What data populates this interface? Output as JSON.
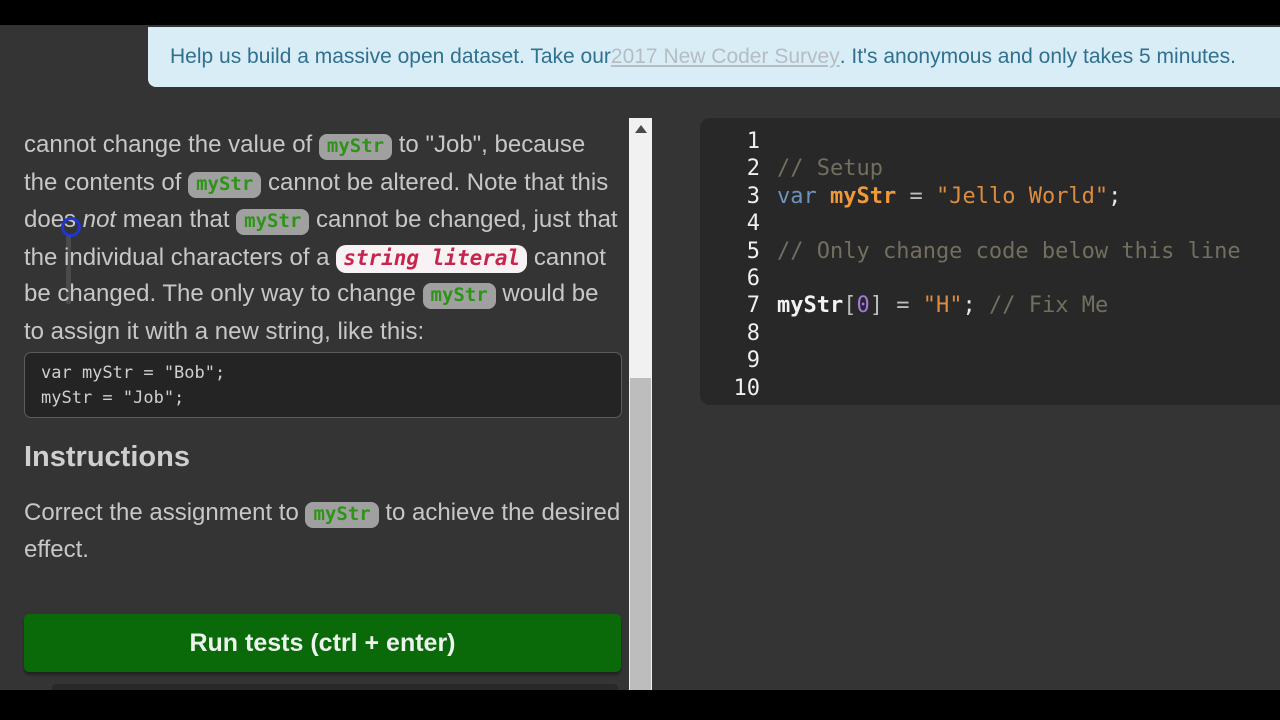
{
  "banner": {
    "text_before": "Help us build a massive open dataset. Take our ",
    "link_text": "2017 New Coder Survey",
    "text_after": ". It's anonymous and only takes 5 minutes."
  },
  "lesson": {
    "description": [
      {
        "t": "text",
        "s": "cannot change the value of "
      },
      {
        "t": "code",
        "s": "myStr"
      },
      {
        "t": "text",
        "s": " to \"Job\", because the contents of "
      },
      {
        "t": "code",
        "s": "myStr"
      },
      {
        "t": "text",
        "s": " cannot be altered. Note that this does "
      },
      {
        "t": "em",
        "s": "not"
      },
      {
        "t": "text",
        "s": " mean that "
      },
      {
        "t": "code",
        "s": "myStr"
      },
      {
        "t": "text",
        "s": " cannot be changed, just that the individual characters of a "
      },
      {
        "t": "code-red",
        "s": "string literal"
      },
      {
        "t": "text",
        "s": " cannot be changed. The only way to change "
      },
      {
        "t": "code",
        "s": "myStr"
      },
      {
        "t": "text",
        "s": " would be to assign it with a new string, like this:"
      }
    ],
    "example_code": [
      "var myStr = \"Bob\";",
      "myStr = \"Job\";"
    ],
    "instructions_title": "Instructions",
    "instructions": [
      {
        "t": "text",
        "s": "Correct the assignment to "
      },
      {
        "t": "code",
        "s": "myStr"
      },
      {
        "t": "text",
        "s": " to achieve the desired effect."
      }
    ],
    "run_button_label": "Run tests (ctrl + enter)"
  },
  "editor": {
    "lines": [
      {
        "num": "1",
        "tokens": []
      },
      {
        "num": "2",
        "tokens": [
          {
            "c": "comment",
            "s": "// Setup"
          }
        ]
      },
      {
        "num": "3",
        "tokens": [
          {
            "c": "kw",
            "s": "var"
          },
          {
            "c": "plain",
            "s": " "
          },
          {
            "c": "def",
            "s": "myStr"
          },
          {
            "c": "op",
            "s": " = "
          },
          {
            "c": "str",
            "s": "\"Jello World\""
          },
          {
            "c": "plain",
            "s": ";"
          }
        ]
      },
      {
        "num": "4",
        "tokens": []
      },
      {
        "num": "5",
        "tokens": [
          {
            "c": "comment",
            "s": "// Only change code below this line"
          }
        ]
      },
      {
        "num": "6",
        "tokens": []
      },
      {
        "num": "7",
        "tokens": [
          {
            "c": "defwhite",
            "s": "myStr"
          },
          {
            "c": "op",
            "s": "["
          },
          {
            "c": "num",
            "s": "0"
          },
          {
            "c": "op",
            "s": "]"
          },
          {
            "c": "op",
            "s": " = "
          },
          {
            "c": "str",
            "s": "\"H\""
          },
          {
            "c": "plain",
            "s": "; "
          },
          {
            "c": "comment",
            "s": "// Fix Me"
          }
        ]
      },
      {
        "num": "8",
        "tokens": []
      },
      {
        "num": "9",
        "tokens": []
      },
      {
        "num": "10",
        "tokens": []
      }
    ]
  },
  "colors": {
    "page_bg": "#343434",
    "editor_bg": "#282828",
    "banner_bg": "#d9edf7",
    "banner_text": "#31708f",
    "button_green": "#0a6a0a",
    "inline_code_green": "#2e9418",
    "inline_code_red": "#c7254e",
    "editor_keyword_blue": "#6d93bd",
    "editor_orange": "#f0993b",
    "editor_string_orange": "#dd8c3f",
    "editor_number_purple": "#9c7bdb",
    "editor_comment": "#726f5f"
  }
}
